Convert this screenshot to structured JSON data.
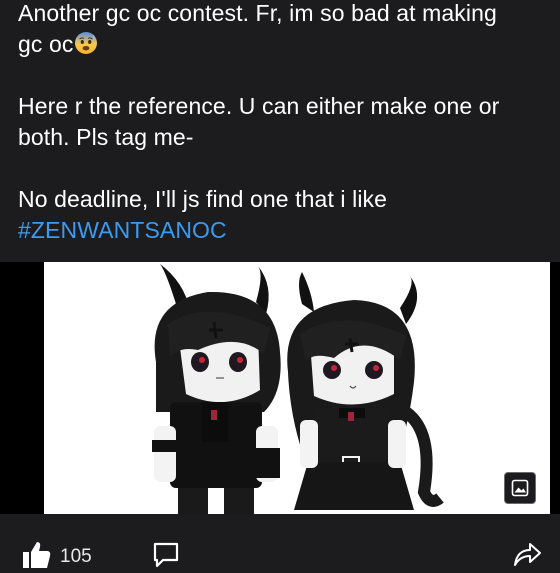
{
  "post": {
    "line1": "Another gc oc contest. Fr, im so bad at making",
    "line2": "gc oc",
    "emoji": "anxious-face-with-sweat",
    "para2": "Here r the reference. U can either make one or both. Pls tag me-",
    "para3": "No deadline, I'll js find one that i like",
    "hashtag": "#ZENWANTSANOC"
  },
  "media": {
    "type": "image",
    "description_icon": "image-gallery-icon"
  },
  "actions": {
    "like_count": "105",
    "like_icon": "thumbs-up-icon",
    "comment_icon": "comment-icon",
    "share_icon": "share-icon"
  },
  "colors": {
    "background": "#1c1c1e",
    "text": "#ffffff",
    "hashtag": "#3b9bf0"
  }
}
